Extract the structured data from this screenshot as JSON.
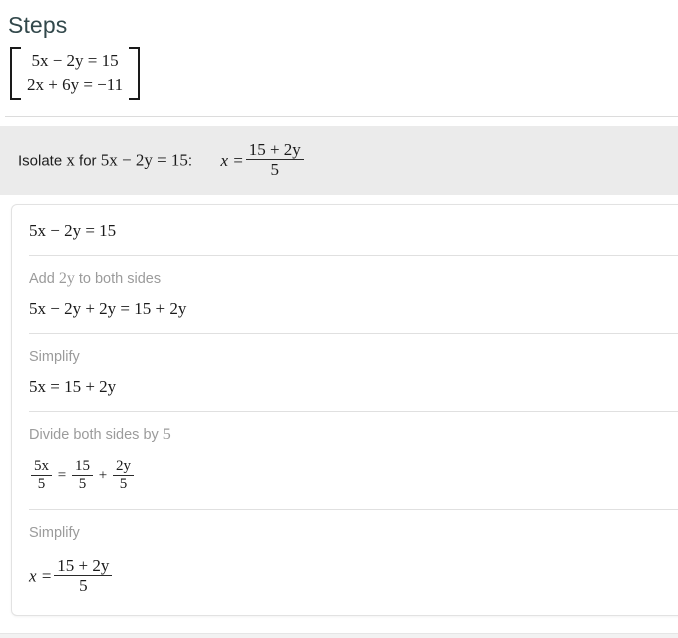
{
  "page": {
    "title": "Steps",
    "title_color": "#32484b",
    "background": "#ffffff"
  },
  "system": {
    "bracket": "square",
    "rows": [
      "5x − 2y = 15",
      "2x + 6y = −11"
    ]
  },
  "banner": {
    "background": "#ebebeb",
    "prefix": "Isolate",
    "variable": "x",
    "middle": "for",
    "equation": "5x − 2y = 15",
    "colon": ":",
    "result_lhs": "x =",
    "result_numerator": "15 + 2y",
    "result_denominator": "5"
  },
  "card": {
    "background": "#ffffff",
    "border_color": "#e2e2e2",
    "steps": [
      {
        "label": null,
        "expression": "5x − 2y = 15"
      },
      {
        "label_prefix": "Add",
        "label_math": "2y",
        "label_suffix": "to both sides",
        "expression": "5x − 2y + 2y = 15 + 2y"
      },
      {
        "label_prefix": "Simplify",
        "label_math": "",
        "label_suffix": "",
        "expression": "5x = 15 + 2y"
      },
      {
        "label_prefix": "Divide both sides by",
        "label_math": "5",
        "label_suffix": "",
        "fraction_equation": {
          "terms": [
            {
              "num": "5x",
              "den": "5"
            },
            {
              "op": "="
            },
            {
              "num": "15",
              "den": "5"
            },
            {
              "op": "+"
            },
            {
              "num": "2y",
              "den": "5"
            }
          ]
        }
      },
      {
        "label_prefix": "Simplify",
        "label_math": "",
        "label_suffix": "",
        "final": {
          "lhs": "x =",
          "numerator": "15 + 2y",
          "denominator": "5"
        }
      }
    ]
  }
}
